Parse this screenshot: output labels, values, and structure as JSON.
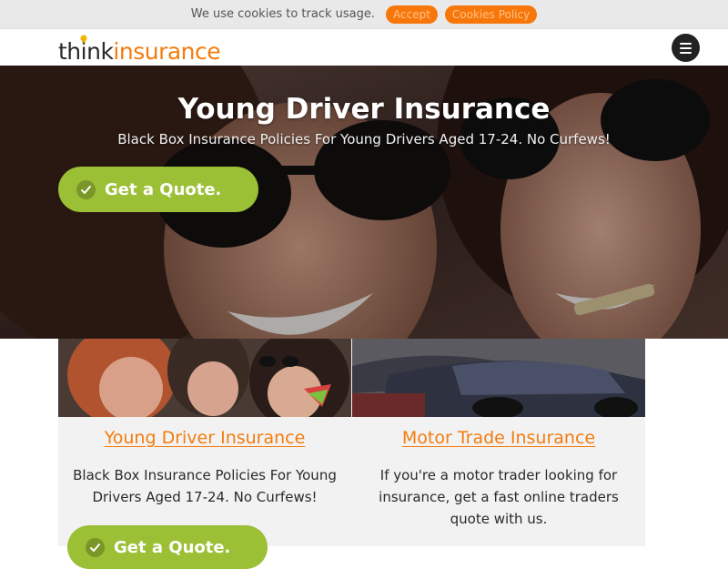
{
  "cookie_bar": {
    "message": "We use cookies to track usage.",
    "accept_label": "Accept",
    "policy_label": "Cookies Policy"
  },
  "header": {
    "logo_part1": "think",
    "logo_part2": "insurance"
  },
  "hero": {
    "title": "Young Driver Insurance",
    "subtitle": "Black Box Insurance Policies For Young Drivers Aged 17-24. No Curfews!",
    "cta_label": "Get a Quote."
  },
  "cards": [
    {
      "title": "Young Driver Insurance",
      "text": "Black Box Insurance Policies For Young Drivers Aged 17-24. No Curfews!",
      "cta_label": "Get a Quote."
    },
    {
      "title": "Motor Trade Insurance",
      "text": "If you're a motor trader looking for insurance, get a fast online traders quote with us."
    }
  ],
  "colors": {
    "accent_orange": "#f47c0e",
    "accent_green": "#9bbf35"
  }
}
